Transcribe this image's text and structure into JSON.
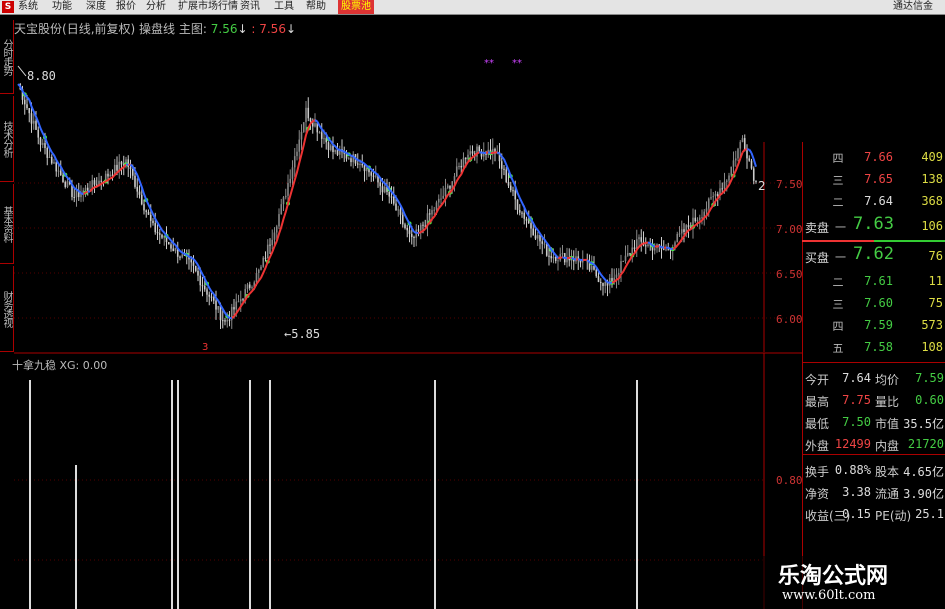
{
  "menu": {
    "logo": "S",
    "items": [
      "系统",
      "功能",
      "深度",
      "报价",
      "分析",
      "扩展市场行情",
      "资讯",
      "工具",
      "帮助"
    ],
    "highlight": "股票池",
    "right_text": "通达信金"
  },
  "side_tabs": [
    "分时走势",
    "技术分析",
    "基本资料",
    "财务透视"
  ],
  "title": {
    "stock": "天宝股份",
    "period": "(日线,前复权)",
    "indicator": "操盘线",
    "main": "主图:",
    "val1": "7.56",
    "arrow1": "↓",
    "sep": ":",
    "val2": "7.56",
    "arrow2": "↓"
  },
  "chart": {
    "high_label": "8.80",
    "low_label": "5.85",
    "y_ticks": [
      "7.50",
      "7.00",
      "6.50",
      "6.00"
    ],
    "extra_label": "2",
    "marker_low": "3",
    "ind_tick": "0.80"
  },
  "indicator": {
    "label": "十拿九稳",
    "key": "XG:",
    "value": "0.00"
  },
  "colors": {
    "up": "#e44",
    "down": "#4c4",
    "ma_up": "#e33",
    "ma_down": "#36f",
    "grid": "#a00"
  },
  "orderbook": {
    "sells": [
      {
        "level": "四",
        "price": "7.66",
        "vol": "409",
        "color": "#e44"
      },
      {
        "level": "三",
        "price": "7.65",
        "vol": "138",
        "color": "#e44"
      },
      {
        "level": "二",
        "price": "7.64",
        "vol": "368",
        "color": "#ddd"
      }
    ],
    "sell_side": "卖盘",
    "sell1": {
      "level": "一",
      "price": "7.63",
      "vol": "106"
    },
    "buy_side": "买盘",
    "buy1": {
      "level": "一",
      "price": "7.62",
      "vol": "76"
    },
    "buys": [
      {
        "level": "二",
        "price": "7.61",
        "vol": "11",
        "color": "#4c4"
      },
      {
        "level": "三",
        "price": "7.60",
        "vol": "75",
        "color": "#4c4"
      },
      {
        "level": "四",
        "price": "7.59",
        "vol": "573",
        "color": "#4c4"
      },
      {
        "level": "五",
        "price": "7.58",
        "vol": "108",
        "color": "#4c4"
      }
    ]
  },
  "stats": [
    [
      {
        "label": "今开",
        "value": "7.64",
        "color": "#ddd"
      },
      {
        "label": "均价",
        "value": "7.59",
        "color": "#4c4"
      }
    ],
    [
      {
        "label": "最高",
        "value": "7.75",
        "color": "#e44"
      },
      {
        "label": "量比",
        "value": "0.60",
        "color": "#4c4"
      }
    ],
    [
      {
        "label": "最低",
        "value": "7.50",
        "color": "#4c4"
      },
      {
        "label": "市值",
        "value": "35.5亿",
        "color": "#ddd"
      }
    ],
    [
      {
        "label": "外盘",
        "value": "12499",
        "color": "#e44"
      },
      {
        "label": "内盘",
        "value": "21720",
        "color": "#4c4"
      }
    ],
    [
      {
        "label": "换手",
        "value": "0.88%",
        "color": "#ddd"
      },
      {
        "label": "股本",
        "value": "4.65亿",
        "color": "#ddd"
      }
    ],
    [
      {
        "label": "净资",
        "value": "3.38",
        "color": "#ddd"
      },
      {
        "label": "流通",
        "value": "3.90亿",
        "color": "#ddd"
      }
    ],
    [
      {
        "label": "收益(三)",
        "value": "0.15",
        "color": "#ddd"
      },
      {
        "label": "PE(动)",
        "value": "25.1",
        "color": "#ddd"
      }
    ]
  ],
  "watermark": {
    "line1": "乐淘公式网",
    "line2": "www.60lt.com"
  }
}
